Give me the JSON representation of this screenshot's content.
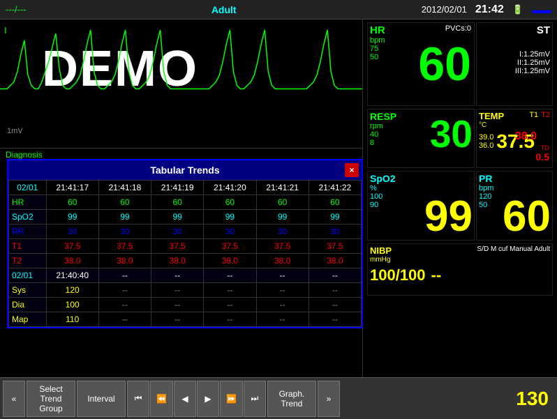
{
  "topBar": {
    "left": "---/---",
    "center": "Adult",
    "date": "2012/02/01",
    "time": "21:42",
    "batteryIcon": "🔋"
  },
  "ecg": {
    "leadLabel": "I",
    "demoText": "DEMO",
    "scale": "1mV"
  },
  "diagnosis": {
    "label": "Diagnosis"
  },
  "trendsDialog": {
    "title": "Tabular Trends",
    "closeLabel": "×",
    "columns": [
      "02/01",
      "21:41:17",
      "21:41:18",
      "21:41:19",
      "21:41:20",
      "21:41:21",
      "21:41:22"
    ],
    "rows": [
      {
        "label": "HR",
        "type": "hr",
        "values": [
          "60",
          "60",
          "60",
          "60",
          "60",
          "60"
        ]
      },
      {
        "label": "SpO2",
        "type": "spo2",
        "values": [
          "99",
          "99",
          "99",
          "99",
          "99",
          "99"
        ]
      },
      {
        "label": "RR",
        "type": "rr",
        "values": [
          "30",
          "30",
          "30",
          "30",
          "30",
          "30"
        ]
      },
      {
        "label": "T1",
        "type": "t1",
        "values": [
          "37.5",
          "37.5",
          "37.5",
          "37.5",
          "37.5",
          "37.5"
        ]
      },
      {
        "label": "T2",
        "type": "t2",
        "values": [
          "38.0",
          "38.0",
          "38.0",
          "38.0",
          "38.0",
          "38.0"
        ]
      }
    ],
    "section2": {
      "header": [
        "02/01",
        "21:40:40",
        "--",
        "--",
        "--",
        "--",
        "--"
      ],
      "rows": [
        {
          "label": "Sys",
          "values": [
            "120",
            "--",
            "--",
            "--",
            "--",
            "--"
          ]
        },
        {
          "label": "Dia",
          "values": [
            "100",
            "--",
            "--",
            "--",
            "--",
            "--"
          ]
        },
        {
          "label": "Map",
          "values": [
            "110",
            "--",
            "--",
            "--",
            "--",
            "--"
          ]
        }
      ]
    }
  },
  "vitals": {
    "hr": {
      "label": "HR",
      "unit": "bpm",
      "value": "60",
      "scale1": "75",
      "scale2": "50",
      "pvcs": "PVCs:0"
    },
    "st": {
      "label": "ST",
      "i": "I:1.25mV",
      "ii": "II:1.25mV",
      "iii": "III:1.25mV"
    },
    "resp": {
      "label": "RESP",
      "unit": "rpm",
      "value": "30",
      "scale1": "40",
      "scale2": "8"
    },
    "temp": {
      "label": "TEMP",
      "t1label": "T1",
      "t2label": "T2",
      "unit": "°C",
      "vals": [
        "39.0",
        "36.0"
      ],
      "bigVal": "37.5",
      "t2val": "38.0",
      "tdLabel": "TD",
      "tdVal": "0.5"
    },
    "spo2": {
      "label": "SpO2",
      "unit": "%",
      "value": "99",
      "scale1": "100",
      "scale2": "90"
    },
    "pr": {
      "label": "PR",
      "unit": "bpm",
      "value": "60",
      "scale1": "120",
      "scale2": "50"
    },
    "nibp": {
      "label": "NIBP",
      "info": "S/D M cuf Manual Adult",
      "unit": "mmHg",
      "value": "100/100",
      "dash": "--"
    }
  },
  "bottomBar": {
    "prevBtn": "«",
    "selectTrendGroup": "Select\nTrend\nGroup",
    "interval": "Interval",
    "navFirst": "⏮",
    "navPrev": "⏪",
    "navPrevStep": "◀",
    "navNextStep": "▶",
    "navNext": "⏩",
    "navLast": "⏭",
    "graphTrend": "Graph.\nTrend",
    "nextBtn": "»",
    "rightNumber": "130"
  }
}
